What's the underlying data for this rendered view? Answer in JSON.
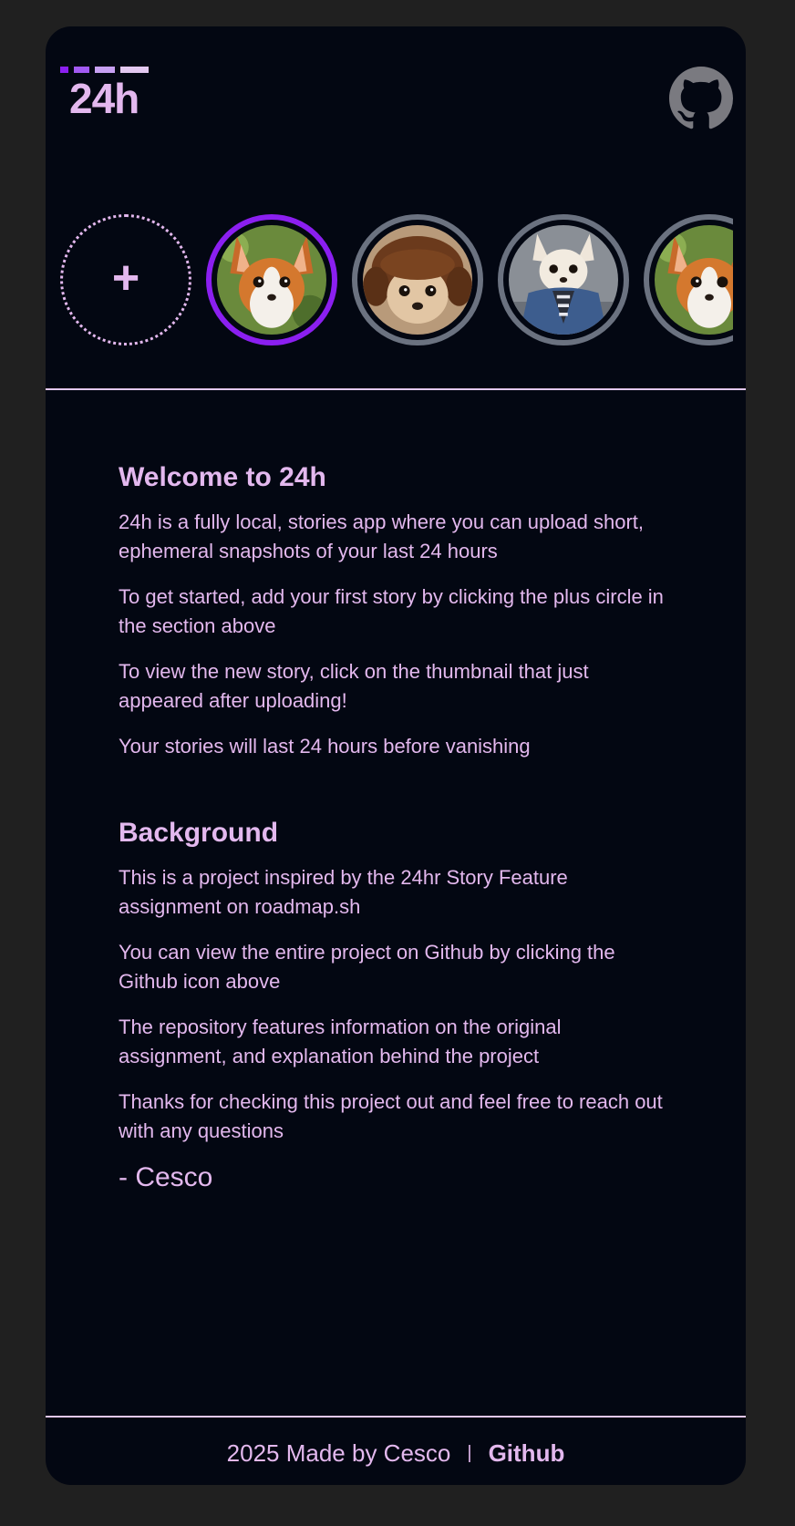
{
  "header": {
    "logo_text": "24h",
    "logo_bar_colors": [
      "#8b1ff0",
      "#a25af2",
      "#c7a0f2",
      "#e3c8f0"
    ],
    "github_icon": "github-icon"
  },
  "stories": {
    "add_symbol": "+",
    "items": [
      {
        "thumb": "chihuahua-orange",
        "active": true
      },
      {
        "thumb": "chihuahua-wig",
        "active": false
      },
      {
        "thumb": "chihuahua-denim",
        "active": false
      },
      {
        "thumb": "chihuahua-orange",
        "active": false
      }
    ]
  },
  "welcome": {
    "title": "Welcome to 24h",
    "paragraphs": [
      "24h is a fully local, stories app where you can upload short, ephemeral snapshots of your last 24 hours",
      "To get started, add your first story by clicking the plus circle in the section above",
      "To view the new story, click on the thumbnail that just appeared after uploading!",
      "Your stories will last 24 hours before vanishing"
    ]
  },
  "background": {
    "title": "Background",
    "paragraphs": [
      "This is a project inspired by the 24hr Story Feature assignment on roadmap.sh",
      "You can view the entire project on Github by clicking the Github icon above",
      "The repository features information on the original assignment, and explanation behind the project",
      "Thanks for checking this project out and feel free to reach out with any questions"
    ],
    "signature": "- Cesco"
  },
  "footer": {
    "credit": "2025 Made by Cesco",
    "separator": "|",
    "link": "Github"
  },
  "colors": {
    "accent": "#8b1ff0",
    "text": "#e3b8ee",
    "panel": "#030712",
    "page": "#202020",
    "ring_inactive": "#6b7280"
  }
}
